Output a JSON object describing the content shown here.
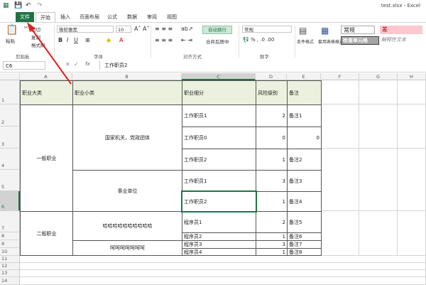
{
  "window": {
    "title": "test.xlsx - Excel"
  },
  "quick_access": {
    "save": "💾",
    "undo": "↶",
    "redo": "↷"
  },
  "tabs": [
    "文件",
    "开始",
    "插入",
    "页面布局",
    "公式",
    "数据",
    "审阅",
    "视图"
  ],
  "ribbon": {
    "clipboard": {
      "paste": "粘贴",
      "cut": "剪切",
      "copy": "复制",
      "format_painter": "格式刷",
      "group": "剪贴板"
    },
    "font": {
      "name": "微软雅黑",
      "size": "10",
      "group": "字体"
    },
    "alignment": {
      "wrap": "自动换行",
      "merge": "合并后居中",
      "group": "对齐方式"
    },
    "number": {
      "format": "常规",
      "group": "数字"
    },
    "styles": {
      "conditional": "条件格式",
      "table": "套用表格格式",
      "normal": "常规",
      "bad": "差",
      "check": "检查单元格",
      "explain": "解释性文本"
    }
  },
  "formula_bar": {
    "name_box": "C6",
    "fx": "fx",
    "value": "工作职员2"
  },
  "colors": {
    "accent": "#217346",
    "header_fill": "#ebf1de"
  },
  "columns": [
    "A",
    "B",
    "C",
    "D",
    "E",
    "F",
    "G",
    "H"
  ],
  "rows": [
    "1",
    "2",
    "3",
    "4",
    "5",
    "6",
    "7",
    "8",
    "9",
    "10",
    "11",
    "12",
    "13",
    "14"
  ],
  "table": {
    "headers": {
      "a": "职业大类",
      "b": "职业小类",
      "c": "职业细分",
      "d": "风险级别",
      "e": "备注"
    },
    "a_groups": [
      "一般职业",
      "二般职业"
    ],
    "b_groups": [
      "国家机关，党政团体",
      "事业单位",
      "哈哈哈哈哈哈哈哈哈哈",
      "呵呵呵呵呵呵呵"
    ],
    "c": [
      "工作职员1",
      "工作职员0",
      "工作职员2",
      "工作职员1",
      "工作职员2",
      "程序员1",
      "程序员2",
      "程序员3",
      "程序员4"
    ],
    "d": [
      "2",
      "0",
      "1",
      "3",
      "1",
      "2",
      "1",
      "3",
      "1"
    ],
    "e": [
      "备注1",
      "0",
      "备注2",
      "备注3",
      "备注4",
      "备注5",
      "备注6",
      "备注7",
      "备注8"
    ]
  }
}
